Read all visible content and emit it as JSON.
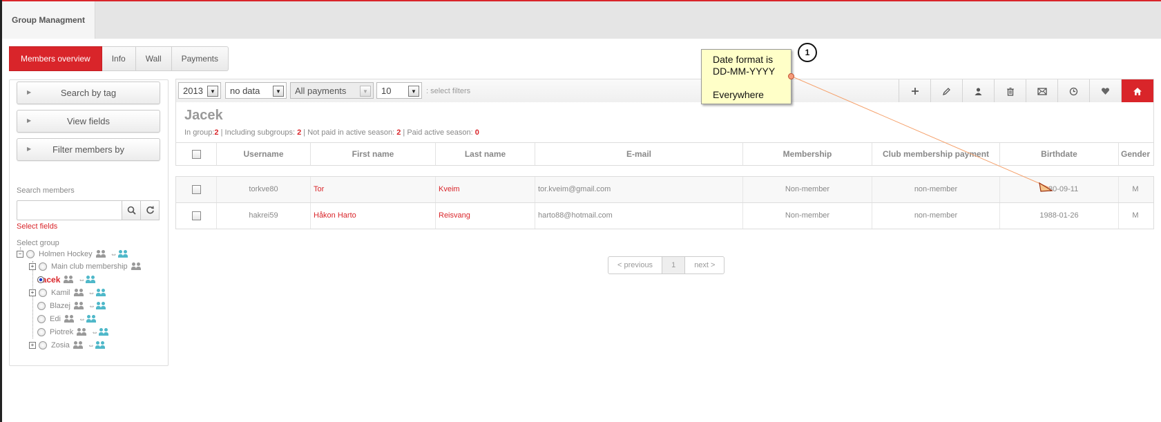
{
  "topbar": {
    "tab_label": "Group Managment"
  },
  "subtabs": [
    "Members overview",
    "Info",
    "Wall",
    "Payments"
  ],
  "sidebar": {
    "buttons": [
      "Search by tag",
      "View fields",
      "Filter members by"
    ],
    "search_label": "Search members",
    "search_value": "",
    "select_fields": "Select fields",
    "select_group_label": "Select group",
    "tree": [
      {
        "label": "Holmen Hockey",
        "selected": false
      },
      {
        "label": "Main club membership",
        "selected": false
      },
      {
        "label": "Jacek",
        "selected": true
      },
      {
        "label": "Kamil",
        "selected": false
      },
      {
        "label": "Blazej",
        "selected": false
      },
      {
        "label": "Edi",
        "selected": false
      },
      {
        "label": "Piotrek",
        "selected": false
      },
      {
        "label": "Zosia",
        "selected": false
      }
    ]
  },
  "filters": {
    "year": "2013",
    "data": "no data",
    "payments": "All payments",
    "per_page": "10",
    "hint": ": select filters"
  },
  "toolbar_icons": [
    "plus-icon",
    "pencil-icon",
    "user-icon",
    "trash-icon",
    "mail-icon",
    "clock-icon",
    "heart-icon",
    "home-icon"
  ],
  "group": {
    "title": "Jacek",
    "stats": {
      "in_group_label": "In group:",
      "in_group": "2",
      "sub_label": " | Including subgroups: ",
      "subgroups": "2",
      "notpaid_label": " | Not paid in active season: ",
      "not_paid": "2",
      "paid_label": " | Paid active season: ",
      "paid": "0"
    }
  },
  "table": {
    "columns": [
      "Username",
      "First name",
      "Last name",
      "E-mail",
      "Membership",
      "Club membership payment",
      "Birthdate",
      "Gender"
    ],
    "rows": [
      [
        "torkve80",
        "Tor",
        "Kveim",
        "tor.kveim@gmail.com",
        "Non-member",
        "non-member",
        "1980-09-11",
        "M"
      ],
      [
        "hakrei59",
        "Håkon Harto",
        "Reisvang",
        "harto88@hotmail.com",
        "Non-member",
        "non-member",
        "1988-01-26",
        "M"
      ]
    ]
  },
  "pager": {
    "prev": "< previous",
    "page": "1",
    "next": "next >"
  },
  "annotation": {
    "lines": [
      "Date format is",
      "DD-MM-YYYY",
      "",
      "Everywhere"
    ],
    "marker": "1"
  },
  "colors": {
    "accent": "#d9252a",
    "note_bg": "#ffffc8"
  }
}
